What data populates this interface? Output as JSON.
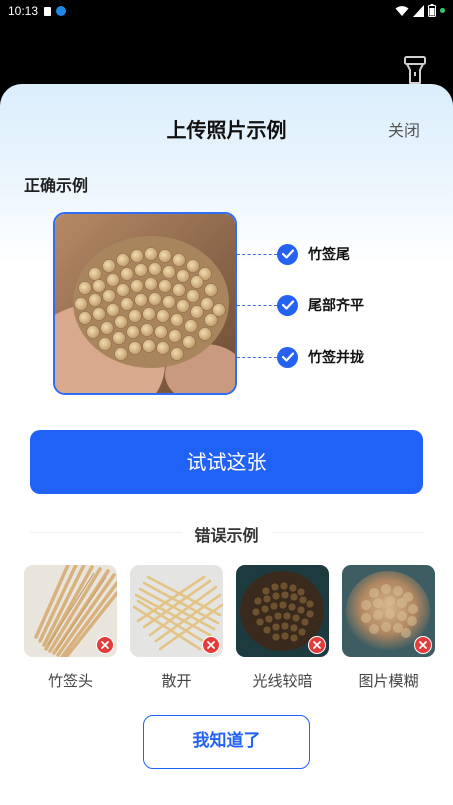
{
  "status_bar": {
    "time": "10:13"
  },
  "sheet": {
    "title": "上传照片示例",
    "close_label": "关闭"
  },
  "correct_section": {
    "title": "正确示例",
    "checks": [
      "竹签尾",
      "尾部齐平",
      "竹签并拢"
    ]
  },
  "try_button_label": "试试这张",
  "wrong_section": {
    "title": "错误示例",
    "items": [
      {
        "label": "竹签头"
      },
      {
        "label": "散开"
      },
      {
        "label": "光线较暗"
      },
      {
        "label": "图片模糊"
      }
    ]
  },
  "ok_button_label": "我知道了",
  "colors": {
    "primary": "#2062f6",
    "check": "#2562f0",
    "error": "#e43b3b"
  },
  "icons": [
    "flashlight-icon",
    "check-icon",
    "close-x-icon"
  ]
}
